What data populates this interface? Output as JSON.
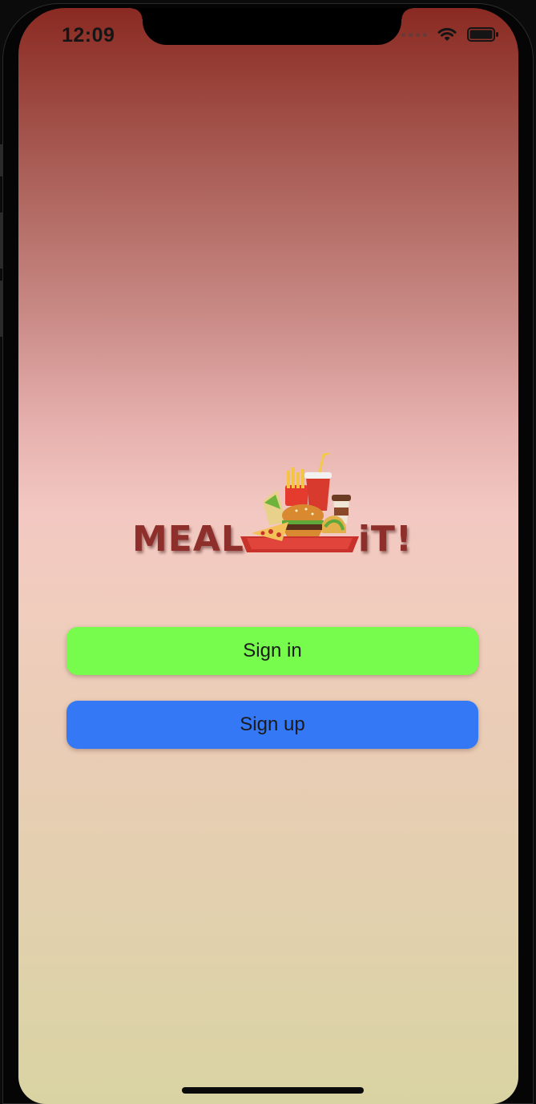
{
  "status_bar": {
    "time": "12:09",
    "icons": [
      "cellular-signal-icon",
      "wifi-icon",
      "battery-icon"
    ]
  },
  "logo": {
    "word_left": "MEAL",
    "word_right": "iT!",
    "art": "fast-food-tray-logo-icon"
  },
  "actions": {
    "sign_in_label": "Sign in",
    "sign_up_label": "Sign up"
  },
  "colors": {
    "sign_in": "#77fb4c",
    "sign_up": "#3478f6",
    "gradient_top": "#8a2a22",
    "gradient_mid": "#f3c8c2",
    "gradient_bottom": "#d9d3a3",
    "logo_text": "#8f2f2b"
  }
}
